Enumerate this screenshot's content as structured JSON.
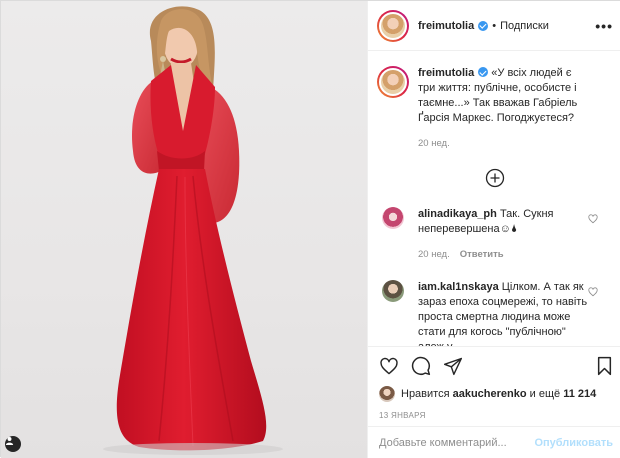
{
  "post": {
    "username": "freimutolia",
    "follow_label": "Подписки",
    "separator": "•",
    "more_label": "•••"
  },
  "caption": {
    "username": "freimutolia",
    "text": "«У всіх людей є три життя: публічне, особисте і таємне...» Так вважав Габріель Ґарсія Маркес. Погоджуєтеся?",
    "age": "20 нед."
  },
  "comments": [
    {
      "username": "alinadikaya_ph",
      "text": "Так. Сукня неперевершена☺🌢",
      "age": "20 нед.",
      "reply_label": "Ответить"
    },
    {
      "username": "iam.kal1nskaya",
      "text": "Цілком. А так як зараз епоха соцмережі, то навіть проста смертна людина може стати для когось \"публічною\" алеж у",
      "age": "",
      "reply_label": ""
    }
  ],
  "likes": {
    "prefix": "Нравится",
    "user": "aakucherenko",
    "joiner": "и ещё",
    "count": "11 214"
  },
  "date": "13 ЯНВАРЯ",
  "add_comment": {
    "placeholder": "Добавьте комментарий...",
    "publish_label": "Опубликовать"
  },
  "colors": {
    "verified": "#3897f0",
    "publish_disabled": "#b2dffc",
    "dress": "#d4142a"
  }
}
